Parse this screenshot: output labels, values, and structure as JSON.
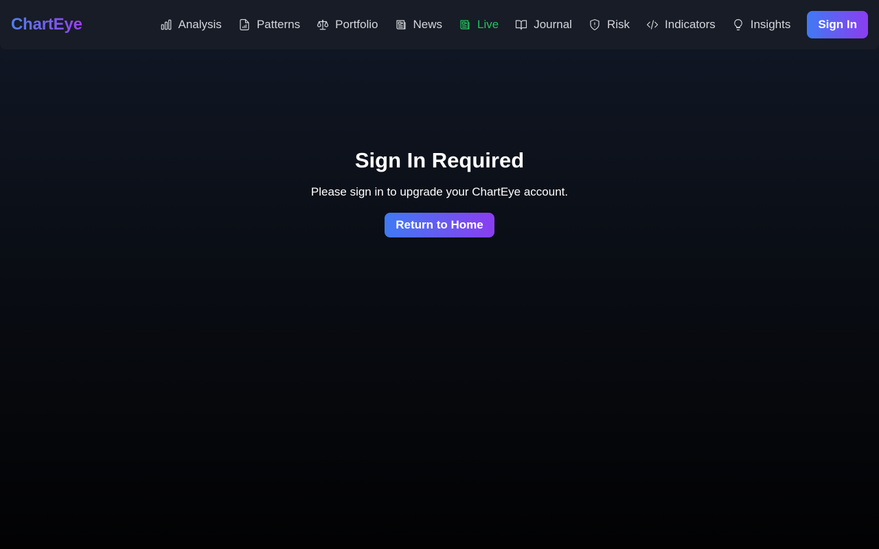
{
  "brand": {
    "name": "ChartEye",
    "gradient_start": "#4f7ff3",
    "gradient_end": "#9b3ff0"
  },
  "nav": {
    "items": [
      {
        "label": "Analysis",
        "icon": "bar-chart-icon",
        "active": false
      },
      {
        "label": "Patterns",
        "icon": "file-chart-icon",
        "active": false
      },
      {
        "label": "Portfolio",
        "icon": "scale-icon",
        "active": false
      },
      {
        "label": "News",
        "icon": "newspaper-icon",
        "active": false
      },
      {
        "label": "Live",
        "icon": "live-newspaper-icon",
        "active": true
      },
      {
        "label": "Journal",
        "icon": "book-icon",
        "active": false
      },
      {
        "label": "Risk",
        "icon": "shield-alert-icon",
        "active": false
      },
      {
        "label": "Indicators",
        "icon": "code-icon",
        "active": false
      },
      {
        "label": "Insights",
        "icon": "lightbulb-icon",
        "active": false
      }
    ],
    "signin_label": "Sign In",
    "active_color": "#22c55e"
  },
  "main": {
    "title": "Sign In Required",
    "message": "Please sign in to upgrade your ChartEye account.",
    "button_label": "Return to Home"
  }
}
